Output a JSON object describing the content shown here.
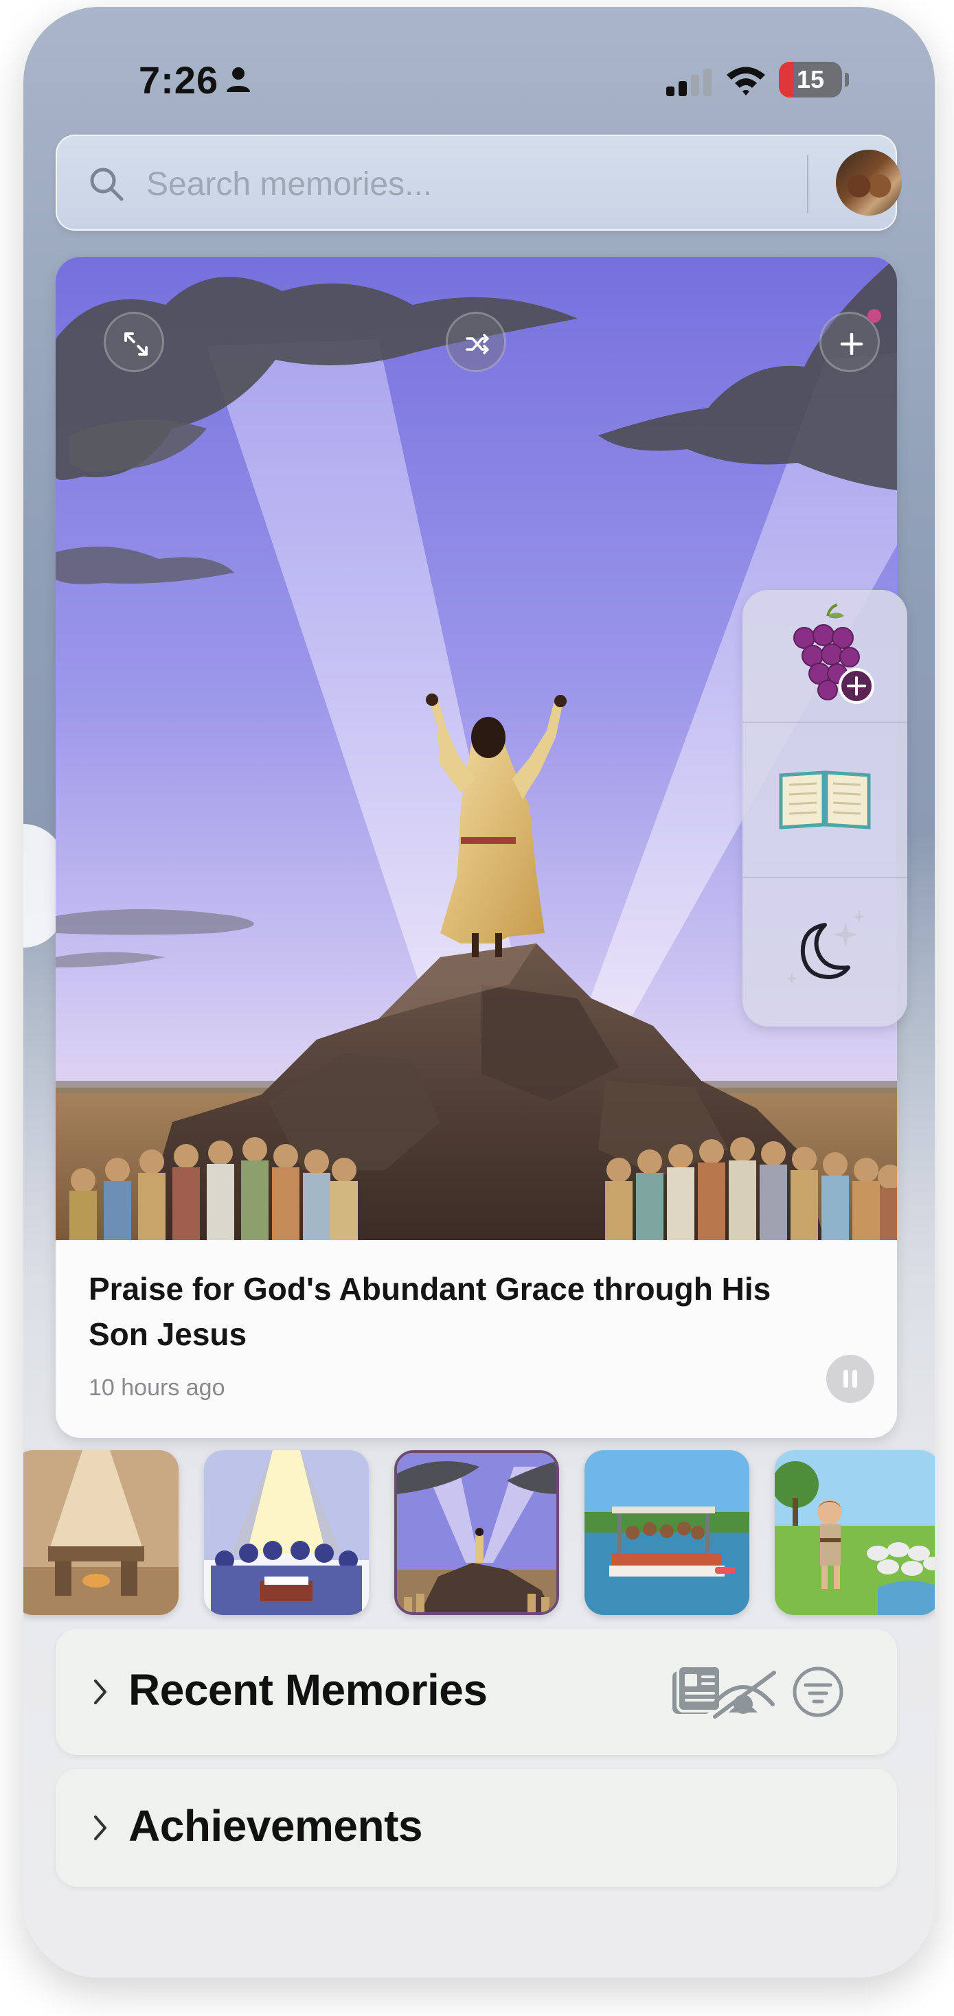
{
  "status_bar": {
    "time": "7:26",
    "battery": "15",
    "icons": [
      "person-icon",
      "cellular-signal-icon",
      "wifi-icon",
      "battery-icon"
    ]
  },
  "search": {
    "placeholder": "Search memories...",
    "value": ""
  },
  "featured": {
    "title": "Praise for God's Abundant Grace through His Son Jesus",
    "time": "10 hours ago",
    "buttons": [
      "expand-icon",
      "shuffle-icon",
      "plus-icon",
      "pause-icon"
    ]
  },
  "side_panel": {
    "items": [
      "grapes-add-icon",
      "open-book-icon",
      "moon-stars-icon"
    ]
  },
  "thumbnails": [
    {
      "name": "altar-light-thumbnail"
    },
    {
      "name": "crowd-bible-thumbnail"
    },
    {
      "name": "praise-mountain-thumbnail",
      "selected": true
    },
    {
      "name": "boat-lake-thumbnail"
    },
    {
      "name": "shepherd-sheep-thumbnail"
    }
  ],
  "sections": {
    "recent": {
      "title": "Recent Memories",
      "icons": [
        "newspaper-icon",
        "hidden-eye-icon",
        "filter-icon"
      ]
    },
    "achievements": {
      "title": "Achievements"
    }
  },
  "colors": {
    "accent_dot": "#c54a86",
    "battery_low": "#e0373a",
    "card_bg": "#fbfbfc",
    "section_bg": "#eef1ee"
  }
}
